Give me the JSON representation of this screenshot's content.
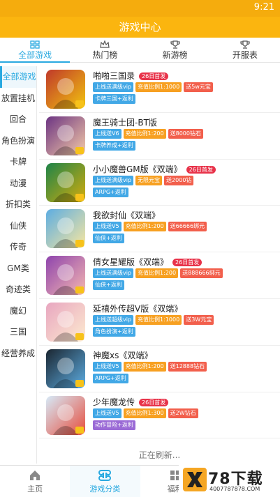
{
  "status_bar": {
    "time": "9:21"
  },
  "header": {
    "title": "游戏中心"
  },
  "tabs": [
    {
      "label": "全部游戏",
      "icon": "grid-icon",
      "active": true
    },
    {
      "label": "热门榜",
      "icon": "crown-icon",
      "active": false
    },
    {
      "label": "新游榜",
      "icon": "trophy-icon",
      "active": false
    },
    {
      "label": "开服表",
      "icon": "trophy-icon",
      "active": false
    }
  ],
  "sidebar": {
    "items": [
      "全部游戏",
      "放置挂机",
      "回合",
      "角色扮演",
      "卡牌",
      "动漫",
      "折扣类",
      "仙侠",
      "传奇",
      "GM类",
      "奇迹类",
      "魔幻",
      "三国",
      "经营养成"
    ]
  },
  "games": [
    {
      "name": "啪啪三国录",
      "badge": "26日首发",
      "tags1": [
        {
          "t": "上线送满级vip",
          "c": "blue"
        },
        {
          "t": "充值比例1:1000",
          "c": "orange"
        },
        {
          "t": "送5w元宝",
          "c": "red"
        }
      ],
      "tags2": [
        {
          "t": "卡牌三国+返利",
          "c": "blue"
        }
      ],
      "art": [
        "#c0392b",
        "#f1c40f"
      ]
    },
    {
      "name": "魔王骑士团-BT版",
      "badge": "",
      "tags1": [
        {
          "t": "上线送V6",
          "c": "blue"
        },
        {
          "t": "充值比例1:200",
          "c": "orange"
        },
        {
          "t": "送8000钻石",
          "c": "red"
        }
      ],
      "tags2": [
        {
          "t": "卡牌养成+返利",
          "c": "blue"
        }
      ],
      "art": [
        "#6c3483",
        "#f5cba7"
      ]
    },
    {
      "name": "小小魔兽GM版《双端》",
      "badge": "26日首发",
      "tags1": [
        {
          "t": "上线送满级vip",
          "c": "blue"
        },
        {
          "t": "无限元宝",
          "c": "orange"
        },
        {
          "t": "送2000钻",
          "c": "red"
        }
      ],
      "tags2": [
        {
          "t": "ARPG+返利",
          "c": "blue"
        }
      ],
      "art": [
        "#1e8449",
        "#d4ac0d"
      ]
    },
    {
      "name": "我欲封仙《双端》",
      "badge": "",
      "tags1": [
        {
          "t": "上线送V5",
          "c": "blue"
        },
        {
          "t": "充值比例1:200",
          "c": "orange"
        },
        {
          "t": "送66666绑元",
          "c": "red"
        }
      ],
      "tags2": [
        {
          "t": "仙侠+返利",
          "c": "blue"
        }
      ],
      "art": [
        "#5dade2",
        "#f9e79f"
      ]
    },
    {
      "name": "倩女星耀版《双端》",
      "badge": "26日首发",
      "tags1": [
        {
          "t": "上线送满级vip",
          "c": "blue"
        },
        {
          "t": "充值比例1:200",
          "c": "orange"
        },
        {
          "t": "送888666绑元",
          "c": "red"
        }
      ],
      "tags2": [
        {
          "t": "仙侠+返利",
          "c": "blue"
        }
      ],
      "art": [
        "#8e44ad",
        "#f5b7b1"
      ]
    },
    {
      "name": "延禧外传超V版《双端》",
      "badge": "",
      "tags1": [
        {
          "t": "上线送超级vip",
          "c": "blue"
        },
        {
          "t": "充值比例1:1000",
          "c": "orange"
        },
        {
          "t": "送3W元宝",
          "c": "red"
        }
      ],
      "tags2": [
        {
          "t": "角色扮演+返利",
          "c": "blue"
        }
      ],
      "art": [
        "#e8a6c0",
        "#fdebd0"
      ]
    },
    {
      "name": "神魔xs《双端》",
      "badge": "",
      "tags1": [
        {
          "t": "上线送V5",
          "c": "blue"
        },
        {
          "t": "充值比例1:200",
          "c": "orange"
        },
        {
          "t": "送12888钻石",
          "c": "red"
        }
      ],
      "tags2": [
        {
          "t": "ARPG+返利",
          "c": "blue"
        }
      ],
      "art": [
        "#1b2631",
        "#5dade2"
      ]
    },
    {
      "name": "少年魔龙传",
      "badge": "26日首发",
      "tags1": [
        {
          "t": "上线送V5",
          "c": "blue"
        },
        {
          "t": "充值比例1:300",
          "c": "orange"
        },
        {
          "t": "送2W钻石",
          "c": "red"
        }
      ],
      "tags2": [
        {
          "t": "动作冒险+返利",
          "c": "purple"
        }
      ],
      "art": [
        "#d6eaf8",
        "#e74c3c"
      ]
    }
  ],
  "list_footer": "正在刷新...",
  "bottom_nav": [
    {
      "label": "主页",
      "icon": "home-icon",
      "active": false
    },
    {
      "label": "游戏分类",
      "icon": "category-icon",
      "active": true
    },
    {
      "label": "福利",
      "icon": "gift-icon",
      "active": false
    },
    {
      "label": "",
      "icon": "user-icon",
      "active": false
    }
  ],
  "watermark": {
    "big": "78下载",
    "small": "4007787878.COM"
  },
  "colors": {
    "accent": "#29a9e0",
    "header": "#fbb50f",
    "badge": "#e8334a"
  }
}
